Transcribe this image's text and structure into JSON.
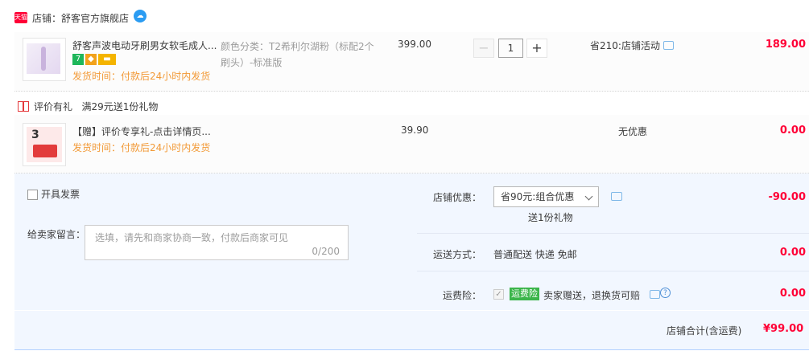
{
  "shop": {
    "badge": "天猫",
    "name": "店铺：舒客官方旗舰店",
    "ww_icon": "wangwang-chat-icon"
  },
  "items": [
    {
      "title": "舒客声波电动牙刷男女软毛成人...",
      "sku": "颜色分类：T2希利尔湖粉（标配2个刷头）-标准版",
      "ship": "发货时间：付款后24小时内发货",
      "price": "399.00",
      "quantity": "1",
      "promo": "省210:店铺活动",
      "subtotal": "189.00",
      "tags": [
        "7",
        "shield-icon",
        "card-icon"
      ]
    },
    {
      "title": "【赠】评价专享礼-点击详情页...",
      "ship": "发货时间：付款后24小时内发货",
      "price": "39.90",
      "promo": "无优惠",
      "subtotal": "0.00",
      "thumb_number": "3"
    }
  ],
  "gift_notice": {
    "label": "评价有礼",
    "text": "满29元送1份礼物"
  },
  "invoice": {
    "label": "开具发票"
  },
  "message": {
    "label": "给卖家留言：",
    "placeholder": "选填，请先和商家协商一致，付款后商家可见",
    "count": "0/200"
  },
  "discount": {
    "label": "店铺优惠：",
    "selected": "省90元:组合优惠",
    "gift": "送1份礼物",
    "amount": "-90.00"
  },
  "shipping": {
    "label": "运送方式：",
    "value": "普通配送 快递 免邮",
    "amount": "0.00"
  },
  "insurance": {
    "label": "运费险：",
    "badge": "运费险",
    "text": "卖家赠送，退换货可赔",
    "amount": "0.00"
  },
  "total": {
    "label": "店铺合计(含运费)",
    "value": "¥99.00"
  },
  "colors": {
    "accent_red": "#ff0036",
    "ship_orange": "#f29a38",
    "summary_bg": "#f2f7ff"
  }
}
